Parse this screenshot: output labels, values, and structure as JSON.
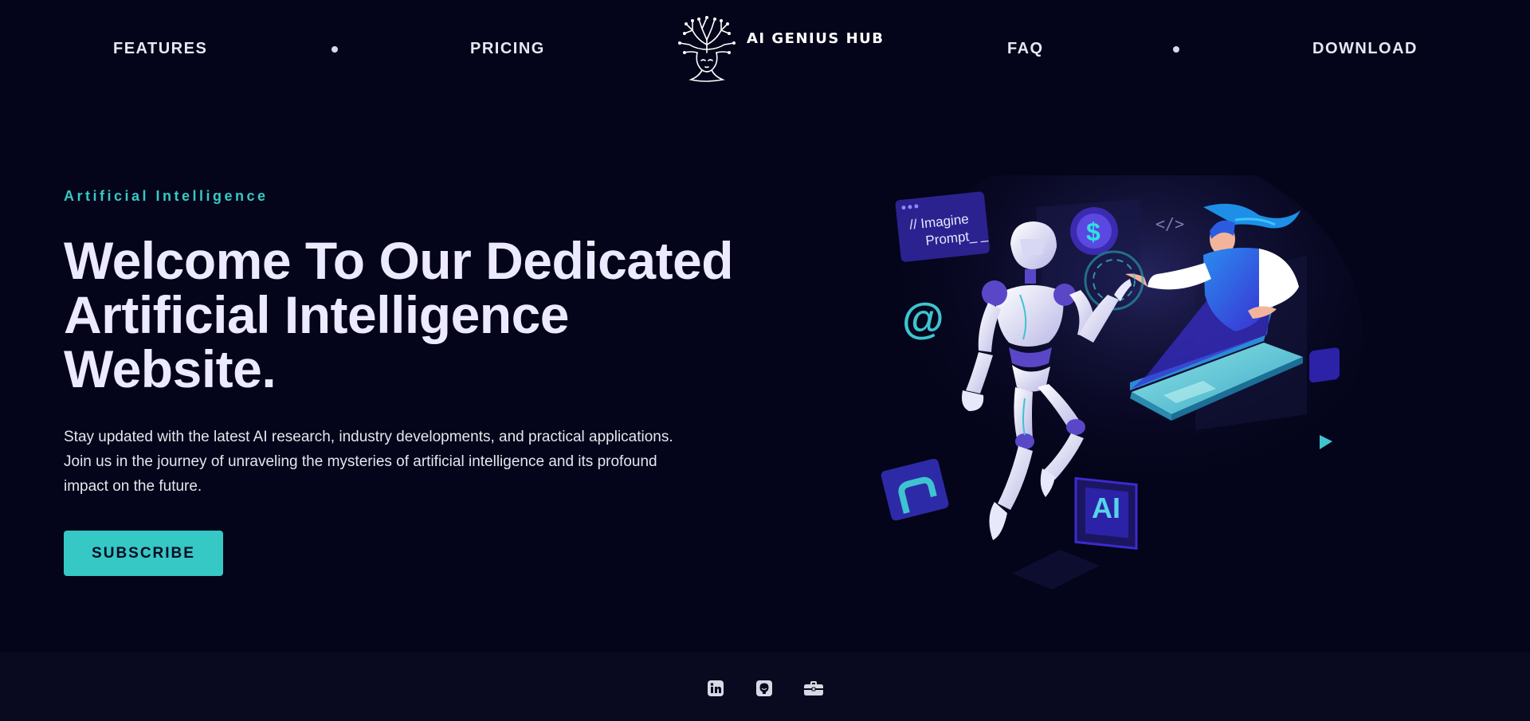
{
  "nav": {
    "links": [
      "FEATURES",
      "PRICING",
      "FAQ",
      "DOWNLOAD"
    ],
    "brand": "AI GENIUS HUB"
  },
  "hero": {
    "eyebrow": "Artificial Intelligence",
    "headline_lines": [
      "Welcome To Our Dedicated",
      "Artificial Intelligence",
      "Website."
    ],
    "lede": "Stay updated with the latest AI research, industry developments, and practical applications. Join us in the journey of unraveling the mysteries of artificial intelligence and its profound impact on the future.",
    "cta": "SUBSCRIBE"
  },
  "illustration": {
    "prompt_line1": "// Imagine",
    "prompt_line2": "Prompt_ _",
    "code_tag": "</>",
    "dollar": "$",
    "at": "@",
    "chip": "AI"
  },
  "footer": {
    "icons": [
      "linkedin-icon",
      "github-icon",
      "briefcase-icon"
    ]
  },
  "colors": {
    "background": "#04041a",
    "footer": "#090920",
    "accent": "#37c9c4",
    "headline": "#eceaff",
    "purple": "#3b2bb0"
  }
}
